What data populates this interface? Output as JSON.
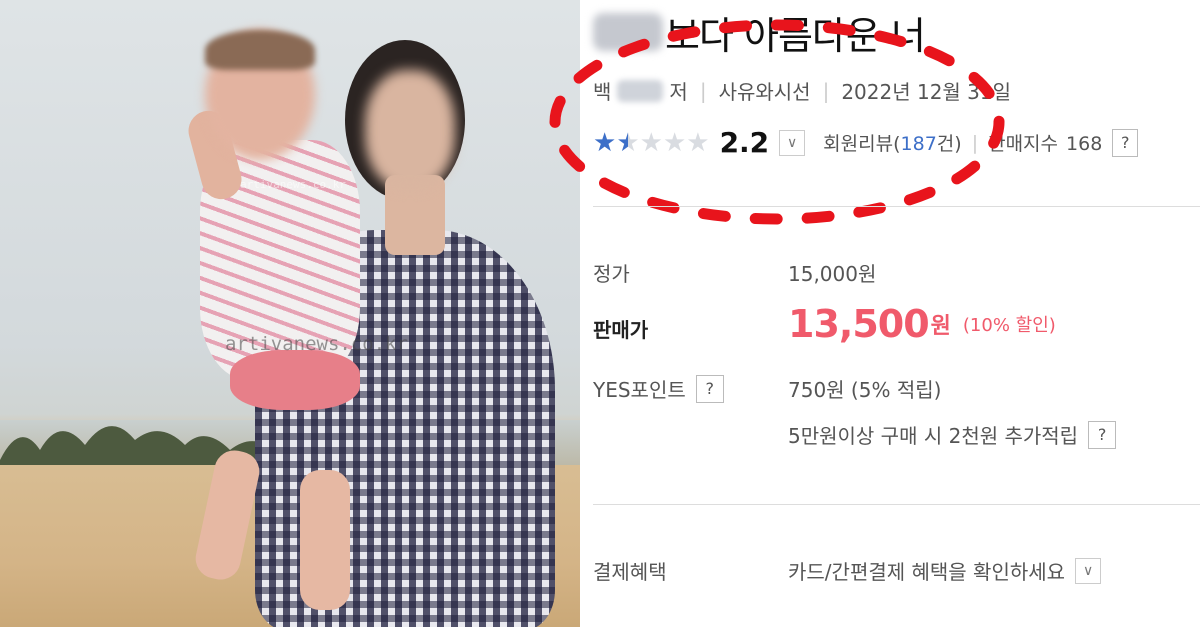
{
  "photo": {
    "watermark_top": "artivanews.co.kr",
    "watermark_mid": "artivanews.co.kr"
  },
  "product": {
    "title": "보다 아름다운 너",
    "author_prefix": "백",
    "author_suffix": "저",
    "publisher": "사유와시선",
    "pub_date": "2022년 12월 31일",
    "rating": "2.2",
    "rating_stars": 1.1,
    "review_label_pre": "회원리뷰(",
    "review_count": "187",
    "review_label_post": "건)",
    "sales_label": "판매지수",
    "sales_value": "168",
    "help_glyph": "?",
    "dropdown_glyph": "∨"
  },
  "pricing": {
    "list_label": "정가",
    "list_price": "15,000원",
    "sale_label": "판매가",
    "sale_price": "13,500",
    "sale_unit": "원",
    "discount": "(10% 할인)",
    "point_label": "YES포인트",
    "point_value": "750원 (5% 적립)",
    "extra_point": "5만원이상 구매 시 2천원 추가적립",
    "benefit_label": "결제혜택",
    "benefit_value": "카드/간편결제 혜택을 확인하세요"
  },
  "colors": {
    "star_filled": "#3d6fc8",
    "star_empty": "#d9dce1",
    "sale_price": "#f05a6b",
    "annotation_oval": "#e8141c"
  }
}
